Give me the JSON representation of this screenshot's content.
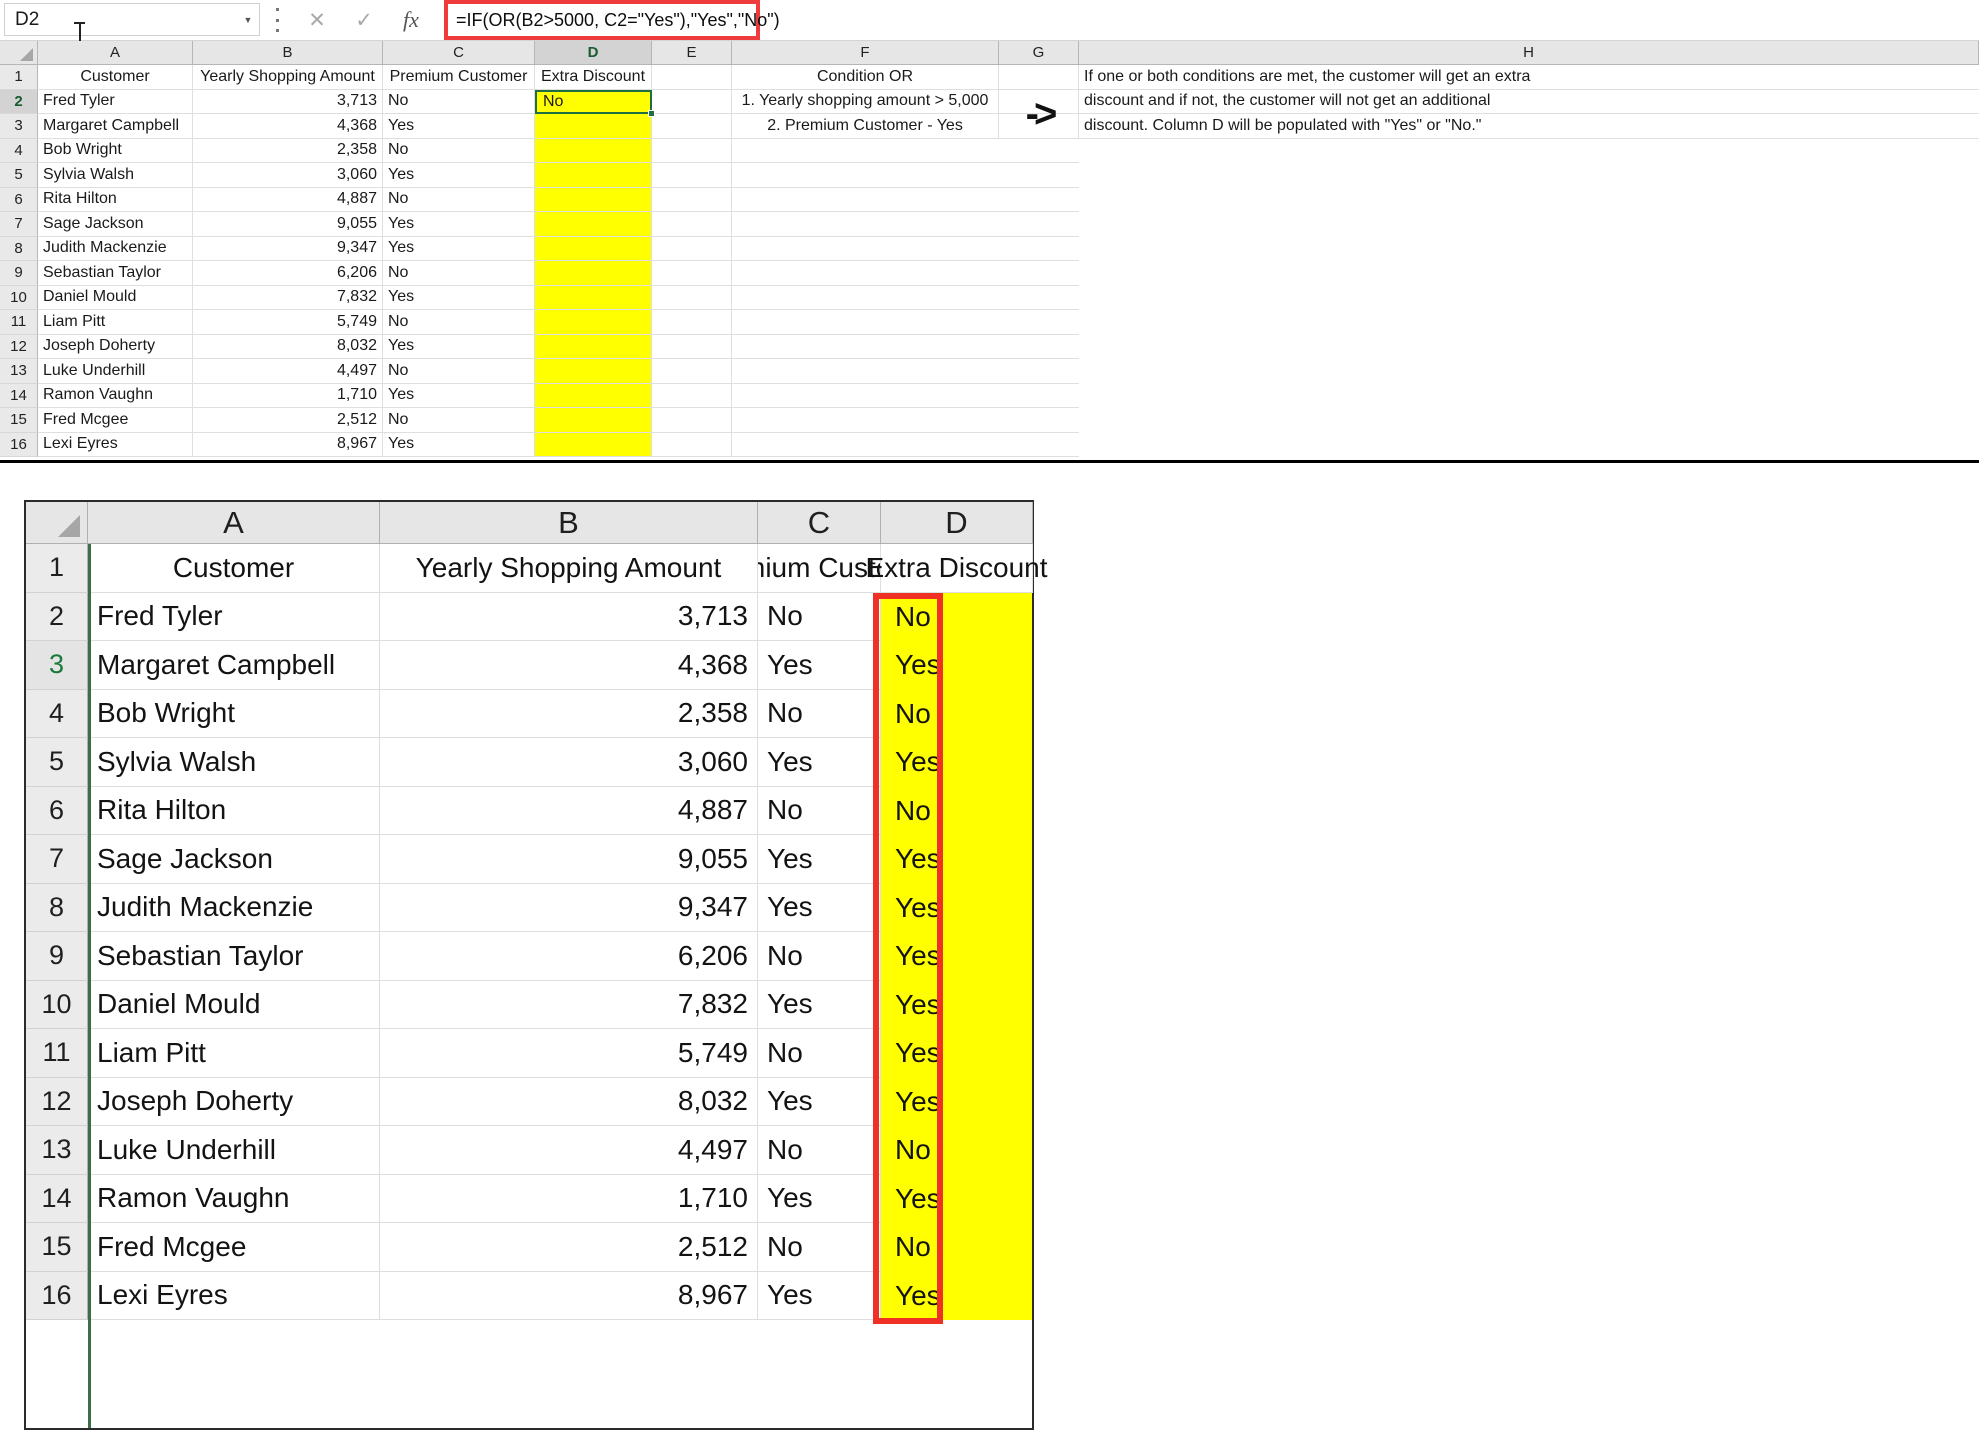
{
  "app": {
    "name_box_value": "D2",
    "name_box_dropdown_icon": "chevron-down-icon",
    "more_options_icon": "vertical-dots-icon",
    "cancel_icon": "close-icon",
    "enter_icon": "check-icon",
    "function_icon": "fx-icon",
    "formula": "=IF(OR(B2>5000, C2=\"Yes\"),\"Yes\",\"No\")",
    "highlight_color": "#ef3b3b",
    "selection_color": "#1d6f42",
    "fill_color": "#ffff00"
  },
  "top_grid": {
    "column_headers": [
      "A",
      "B",
      "C",
      "D",
      "E",
      "F",
      "G",
      "H"
    ],
    "selected_column": "D",
    "selected_row": "2",
    "row_numbers": [
      "1",
      "2",
      "3",
      "4",
      "5",
      "6",
      "7",
      "8",
      "9",
      "10",
      "11",
      "12",
      "13",
      "14",
      "15",
      "16"
    ],
    "headers": {
      "a": "Customer",
      "b": "Yearly Shopping Amount",
      "c": "Premium Customer",
      "d": "Extra Discount"
    },
    "rows": [
      {
        "num": "2",
        "customer": "Fred Tyler",
        "amount": "3,713",
        "premium": "No",
        "discount": "No"
      },
      {
        "num": "3",
        "customer": "Margaret Campbell",
        "amount": "4,368",
        "premium": "Yes",
        "discount": ""
      },
      {
        "num": "4",
        "customer": "Bob Wright",
        "amount": "2,358",
        "premium": "No",
        "discount": ""
      },
      {
        "num": "5",
        "customer": "Sylvia Walsh",
        "amount": "3,060",
        "premium": "Yes",
        "discount": ""
      },
      {
        "num": "6",
        "customer": "Rita Hilton",
        "amount": "4,887",
        "premium": "No",
        "discount": ""
      },
      {
        "num": "7",
        "customer": "Sage Jackson",
        "amount": "9,055",
        "premium": "Yes",
        "discount": ""
      },
      {
        "num": "8",
        "customer": "Judith Mackenzie",
        "amount": "9,347",
        "premium": "Yes",
        "discount": ""
      },
      {
        "num": "9",
        "customer": "Sebastian Taylor",
        "amount": "6,206",
        "premium": "No",
        "discount": ""
      },
      {
        "num": "10",
        "customer": "Daniel Mould",
        "amount": "7,832",
        "premium": "Yes",
        "discount": ""
      },
      {
        "num": "11",
        "customer": "Liam Pitt",
        "amount": "5,749",
        "premium": "No",
        "discount": ""
      },
      {
        "num": "12",
        "customer": "Joseph Doherty",
        "amount": "8,032",
        "premium": "Yes",
        "discount": ""
      },
      {
        "num": "13",
        "customer": "Luke Underhill",
        "amount": "4,497",
        "premium": "No",
        "discount": ""
      },
      {
        "num": "14",
        "customer": "Ramon Vaughn",
        "amount": "1,710",
        "premium": "Yes",
        "discount": ""
      },
      {
        "num": "15",
        "customer": "Fred Mcgee",
        "amount": "2,512",
        "premium": "No",
        "discount": ""
      },
      {
        "num": "16",
        "customer": "Lexi Eyres",
        "amount": "8,967",
        "premium": "Yes",
        "discount": ""
      }
    ],
    "condition_panel": {
      "title": "Condition OR",
      "item_1": "1. Yearly shopping amount > 5,000",
      "item_2": "2. Premium Customer - Yes"
    },
    "arrow_glyph": "->",
    "explanation": {
      "line_1": "If one or both conditions are met, the customer will get an extra",
      "line_2": "discount and if not, the customer will not get an additional",
      "line_3": "discount. Column D will be populated with \"Yes\" or \"No.\""
    }
  },
  "bottom_grid": {
    "column_headers": [
      "A",
      "B",
      "C",
      "D"
    ],
    "headers": {
      "a": "Customer",
      "b": "Yearly Shopping Amount",
      "c": "Premium Customer",
      "d": "Extra Discount"
    },
    "header_row_number": "1",
    "rows": [
      {
        "num": "2",
        "customer": "Fred Tyler",
        "amount": "3,713",
        "premium": "No",
        "discount": "No"
      },
      {
        "num": "3",
        "customer": "Margaret Campbell",
        "amount": "4,368",
        "premium": "Yes",
        "discount": "Yes"
      },
      {
        "num": "4",
        "customer": "Bob Wright",
        "amount": "2,358",
        "premium": "No",
        "discount": "No"
      },
      {
        "num": "5",
        "customer": "Sylvia Walsh",
        "amount": "3,060",
        "premium": "Yes",
        "discount": "Yes"
      },
      {
        "num": "6",
        "customer": "Rita Hilton",
        "amount": "4,887",
        "premium": "No",
        "discount": "No"
      },
      {
        "num": "7",
        "customer": "Sage Jackson",
        "amount": "9,055",
        "premium": "Yes",
        "discount": "Yes"
      },
      {
        "num": "8",
        "customer": "Judith Mackenzie",
        "amount": "9,347",
        "premium": "Yes",
        "discount": "Yes"
      },
      {
        "num": "9",
        "customer": "Sebastian Taylor",
        "amount": "6,206",
        "premium": "No",
        "discount": "Yes"
      },
      {
        "num": "10",
        "customer": "Daniel Mould",
        "amount": "7,832",
        "premium": "Yes",
        "discount": "Yes"
      },
      {
        "num": "11",
        "customer": "Liam Pitt",
        "amount": "5,749",
        "premium": "No",
        "discount": "Yes"
      },
      {
        "num": "12",
        "customer": "Joseph Doherty",
        "amount": "8,032",
        "premium": "Yes",
        "discount": "Yes"
      },
      {
        "num": "13",
        "customer": "Luke Underhill",
        "amount": "4,497",
        "premium": "No",
        "discount": "No"
      },
      {
        "num": "14",
        "customer": "Ramon Vaughn",
        "amount": "1,710",
        "premium": "Yes",
        "discount": "Yes"
      },
      {
        "num": "15",
        "customer": "Fred Mcgee",
        "amount": "2,512",
        "premium": "No",
        "discount": "No"
      },
      {
        "num": "16",
        "customer": "Lexi Eyres",
        "amount": "8,967",
        "premium": "Yes",
        "discount": "Yes"
      }
    ],
    "highlight_box_color": "#ee3124"
  }
}
